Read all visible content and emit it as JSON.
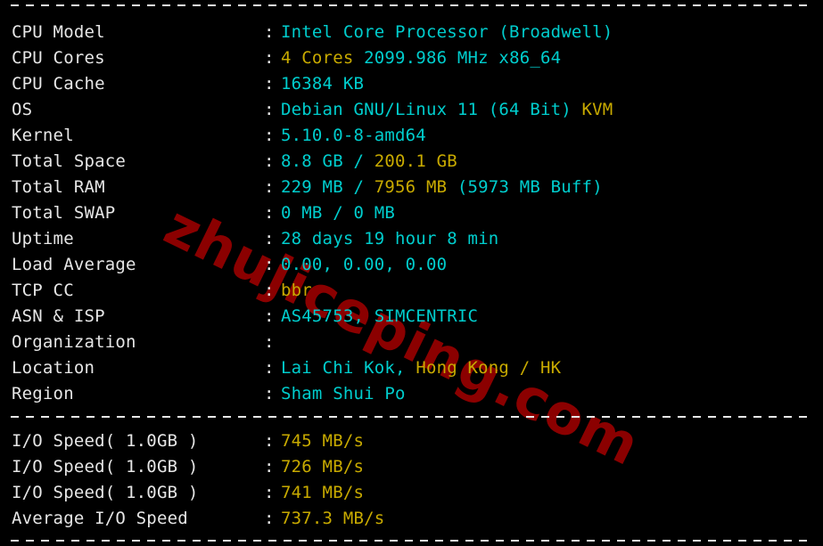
{
  "terminal": {
    "background": "#000000",
    "colors": {
      "label": "#e6e6e6",
      "cyan": "#00cdcd",
      "yellow": "#c8aa00",
      "watermark": "#8b0000"
    },
    "watermark": "zhujiceping.com",
    "separator_char": "-"
  },
  "system_info": {
    "rows": [
      {
        "label": "CPU Model",
        "colon": ":",
        "value": "Intel Core Processor (Broadwell)",
        "segments": [
          {
            "text": "Intel Core Processor (Broadwell)",
            "color": "cyan"
          }
        ]
      },
      {
        "label": "CPU Cores",
        "colon": ":",
        "value": "4 Cores 2099.986 MHz x86_64",
        "segments": [
          {
            "text": "4 Cores ",
            "color": "yellow"
          },
          {
            "text": "2099.986 MHz x86_64",
            "color": "cyan"
          }
        ]
      },
      {
        "label": "CPU Cache",
        "colon": ":",
        "value": "16384 KB",
        "segments": [
          {
            "text": "16384 KB",
            "color": "cyan"
          }
        ]
      },
      {
        "label": "OS",
        "colon": ":",
        "value": "Debian GNU/Linux 11 (64 Bit) KVM",
        "segments": [
          {
            "text": "Debian GNU/Linux 11 (64 Bit) ",
            "color": "cyan"
          },
          {
            "text": "KVM",
            "color": "yellow"
          }
        ]
      },
      {
        "label": "Kernel",
        "colon": ":",
        "value": "5.10.0-8-amd64",
        "segments": [
          {
            "text": "5.10.0-8-amd64",
            "color": "cyan"
          }
        ]
      },
      {
        "label": "Total Space",
        "colon": ":",
        "value": "8.8 GB / 200.1 GB",
        "segments": [
          {
            "text": "8.8 GB / ",
            "color": "cyan"
          },
          {
            "text": "200.1 GB",
            "color": "yellow"
          }
        ]
      },
      {
        "label": "Total RAM",
        "colon": ":",
        "value": "229 MB / 7956 MB (5973 MB Buff)",
        "segments": [
          {
            "text": "229 MB / ",
            "color": "cyan"
          },
          {
            "text": "7956 MB ",
            "color": "yellow"
          },
          {
            "text": "(5973 MB Buff)",
            "color": "cyan"
          }
        ]
      },
      {
        "label": "Total SWAP",
        "colon": ":",
        "value": "0 MB / 0 MB",
        "segments": [
          {
            "text": "0 MB / 0 MB",
            "color": "cyan"
          }
        ]
      },
      {
        "label": "Uptime",
        "colon": ":",
        "value": "28 days 19 hour 8 min",
        "segments": [
          {
            "text": "28 days 19 hour 8 min",
            "color": "cyan"
          }
        ]
      },
      {
        "label": "Load Average",
        "colon": ":",
        "value": "0.00, 0.00, 0.00",
        "segments": [
          {
            "text": "0.00, 0.00, 0.00",
            "color": "cyan"
          }
        ]
      },
      {
        "label": "TCP CC",
        "colon": ":",
        "value": "bbr",
        "segments": [
          {
            "text": "bbr",
            "color": "yellow"
          }
        ]
      },
      {
        "label": "ASN & ISP",
        "colon": ":",
        "value": "AS45753, SIMCENTRIC",
        "segments": [
          {
            "text": "AS45753, SIMCENTRIC",
            "color": "cyan"
          }
        ]
      },
      {
        "label": "Organization",
        "colon": ":",
        "value": "",
        "segments": []
      },
      {
        "label": "Location",
        "colon": ":",
        "value": "Lai Chi Kok, Hong Kong / HK",
        "segments": [
          {
            "text": "Lai Chi Kok, ",
            "color": "cyan"
          },
          {
            "text": "Hong Kong / HK",
            "color": "yellow"
          }
        ]
      },
      {
        "label": "Region",
        "colon": ":",
        "value": "Sham Shui Po",
        "segments": [
          {
            "text": "Sham Shui Po",
            "color": "cyan"
          }
        ]
      }
    ]
  },
  "io_speed": {
    "rows": [
      {
        "label": "I/O Speed( 1.0GB )",
        "colon": ":",
        "value": "745 MB/s",
        "segments": [
          {
            "text": "745 MB/s",
            "color": "yellow"
          }
        ]
      },
      {
        "label": "I/O Speed( 1.0GB )",
        "colon": ":",
        "value": "726 MB/s",
        "segments": [
          {
            "text": "726 MB/s",
            "color": "yellow"
          }
        ]
      },
      {
        "label": "I/O Speed( 1.0GB )",
        "colon": ":",
        "value": "741 MB/s",
        "segments": [
          {
            "text": "741 MB/s",
            "color": "yellow"
          }
        ]
      },
      {
        "label": "Average I/O Speed",
        "colon": ":",
        "value": "737.3 MB/s",
        "segments": [
          {
            "text": "737.3 MB/s",
            "color": "yellow"
          }
        ]
      }
    ]
  }
}
